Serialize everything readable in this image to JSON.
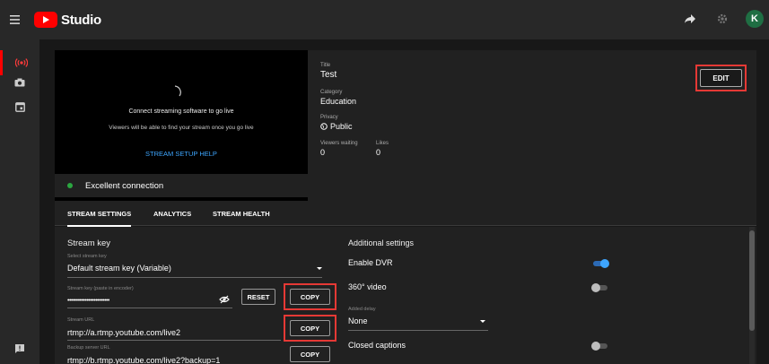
{
  "app": {
    "name": "Studio",
    "avatar_initial": "K"
  },
  "topbar": {
    "menu_icon": "hamburger-menu-icon",
    "share_icon": "share-arrow-icon",
    "settings_icon": "gear-icon"
  },
  "sidebar": {
    "items": [
      {
        "icon": "live-broadcast-icon",
        "active": true
      },
      {
        "icon": "camera-icon",
        "active": false
      },
      {
        "icon": "calendar-icon",
        "active": false
      },
      {
        "icon": "feedback-icon",
        "active": false
      }
    ]
  },
  "preview": {
    "connect_text": "Connect streaming software to go live",
    "viewers_text": "Viewers will be able to find your stream once you go live",
    "setup_help": "STREAM SETUP HELP"
  },
  "details": {
    "title_label": "Title",
    "title_value": "Test",
    "category_label": "Category",
    "category_value": "Education",
    "privacy_label": "Privacy",
    "privacy_value": "Public",
    "viewers_label": "Viewers waiting",
    "viewers_value": "0",
    "likes_label": "Likes",
    "likes_value": "0",
    "edit_label": "EDIT"
  },
  "health": {
    "status_text": "Excellent connection",
    "status_color": "#2ba640"
  },
  "tabs": [
    {
      "label": "STREAM SETTINGS",
      "active": true
    },
    {
      "label": "ANALYTICS",
      "active": false
    },
    {
      "label": "STREAM HEALTH",
      "active": false
    }
  ],
  "stream_settings": {
    "section_title": "Stream key",
    "select_label": "Select stream key",
    "select_value": "Default stream key (Variable)",
    "key_label": "Stream key (paste in encoder)",
    "key_value": "••••••••••••••••••••••••",
    "reset_label": "RESET",
    "copy_label": "COPY",
    "url_label": "Stream URL",
    "url_value": "rtmp://a.rtmp.youtube.com/live2",
    "backup_label": "Backup server URL",
    "backup_value": "rtmp://b.rtmp.youtube.com/live2?backup=1"
  },
  "additional_settings": {
    "section_title": "Additional settings",
    "dvr_label": "Enable DVR",
    "dvr_on": true,
    "video360_label": "360° video",
    "video360_on": false,
    "delay_label": "Added delay",
    "delay_value": "None",
    "captions_label": "Closed captions",
    "captions_on": false
  },
  "colors": {
    "accent": "#3ea6ff",
    "brand": "#ff0000",
    "highlight": "#e53935"
  }
}
